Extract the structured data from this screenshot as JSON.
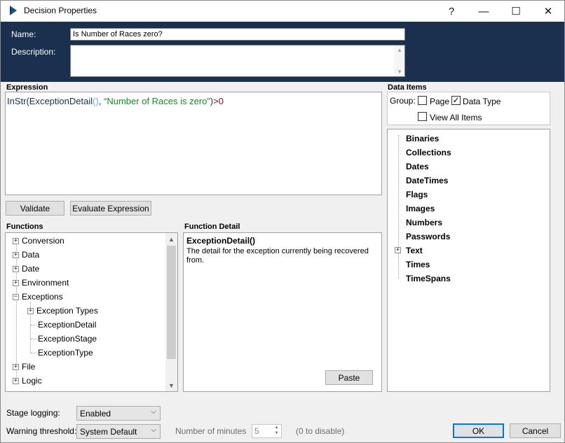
{
  "window": {
    "title": "Decision Properties",
    "help_glyph": "?",
    "minimize_glyph": "—",
    "maximize_glyph": "☐",
    "close_glyph": "✕"
  },
  "header": {
    "name_label": "Name:",
    "name_value": "Is Number of Races zero?",
    "description_label": "Description:",
    "description_value": ""
  },
  "expression": {
    "label": "Expression",
    "tokens": {
      "fn": "InStr(ExceptionDetail",
      "parens": "()",
      "sep": ", ",
      "str": "“Number of Races is zero”",
      "close": ")",
      "op": ">",
      "num": "0"
    },
    "validate_label": "Validate",
    "evaluate_label": "Evaluate Expression"
  },
  "functions": {
    "label": "Functions",
    "items": {
      "conversion": "Conversion",
      "data": "Data",
      "date": "Date",
      "environment": "Environment",
      "exceptions": "Exceptions",
      "exception_types": "Exception Types",
      "exception_detail": "ExceptionDetail",
      "exception_stage": "ExceptionStage",
      "exception_type": "ExceptionType",
      "file": "File",
      "logic": "Logic"
    },
    "plus": "+",
    "minus": "−"
  },
  "function_detail": {
    "label": "Function Detail",
    "title": "ExceptionDetail()",
    "description": "The detail for the exception currently being recovered from.",
    "paste_label": "Paste"
  },
  "data_items": {
    "label": "Data Items",
    "group_label": "Group:",
    "page_label": "Page",
    "page_checked": false,
    "data_type_label": "Data Type",
    "data_type_checked": true,
    "view_all_label": "View All Items",
    "view_all_checked": false,
    "check_glyph": "✓",
    "items": {
      "binaries": "Binaries",
      "collections": "Collections",
      "dates": "Dates",
      "datetimes": "DateTimes",
      "flags": "Flags",
      "images": "Images",
      "numbers": "Numbers",
      "passwords": "Passwords",
      "text": "Text",
      "times": "Times",
      "timespans": "TimeSpans"
    }
  },
  "bottom": {
    "stage_logging_label": "Stage logging:",
    "stage_logging_value": "Enabled",
    "warning_label": "Warning threshold:",
    "warning_value": "System Default",
    "minutes_label": "Number of minutes",
    "minutes_value": "5",
    "disable_hint": "(0 to disable)",
    "ok_label": "OK",
    "cancel_label": "Cancel"
  },
  "colors": {
    "header_bg": "#1b2f4f",
    "string_token": "#118a2b",
    "number_token": "#7a1020",
    "accent": "#0078d7"
  }
}
